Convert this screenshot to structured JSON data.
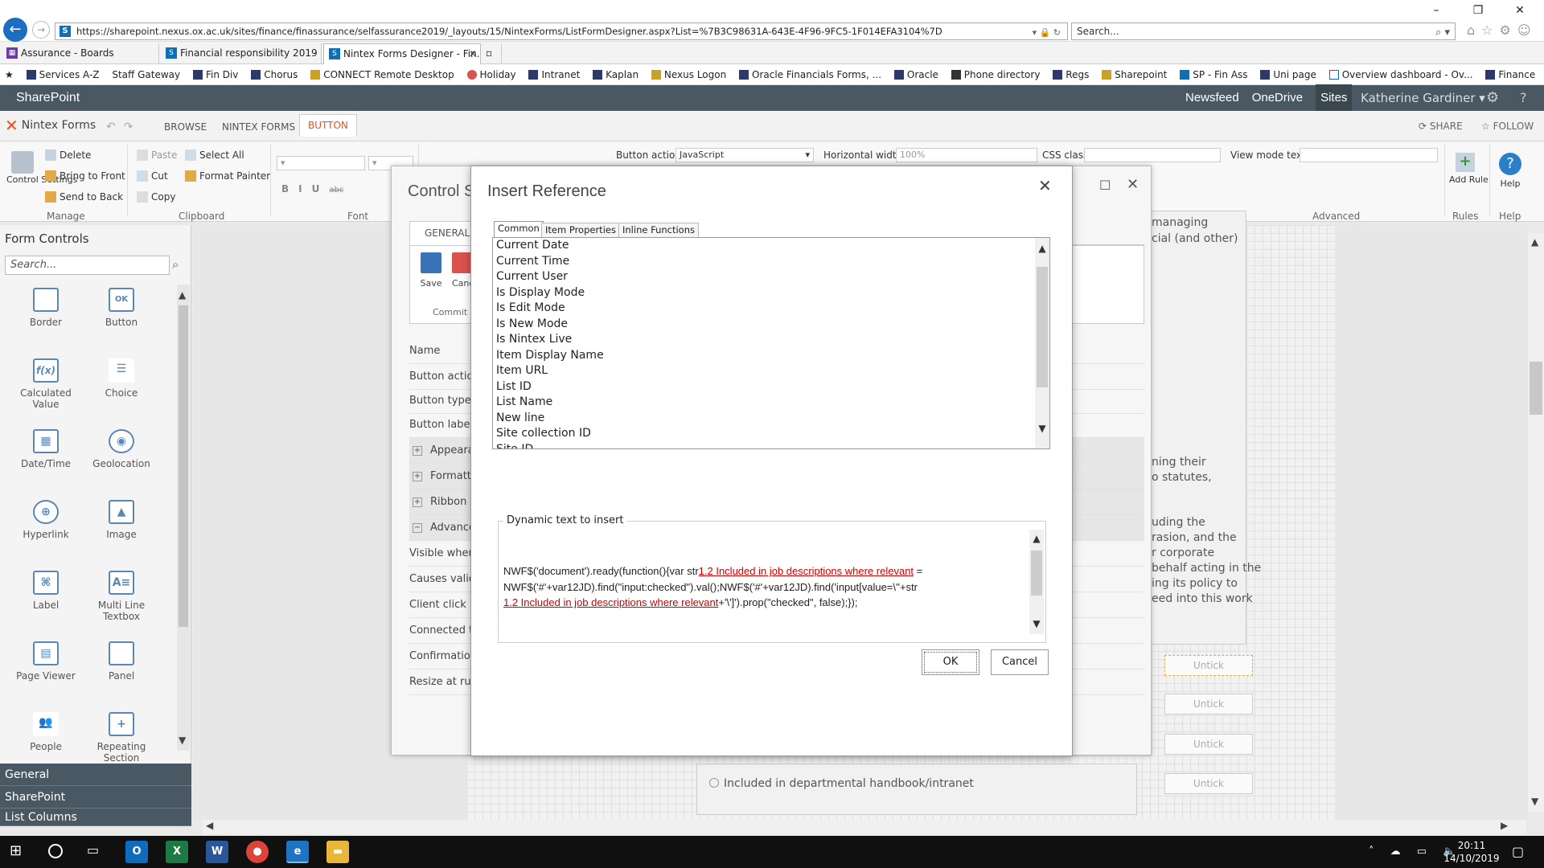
{
  "browser": {
    "url": "https://sharepoint.nexus.ox.ac.uk/sites/finance/finassurance/selfassurance2019/_layouts/15/NintexForms/ListFormDesigner.aspx?List=%7B3C98631A-643E-4F96-9FC5-1F014EFA3104%7D",
    "search_placeholder": "Search...",
    "tabs": [
      "Assurance - Boards",
      "Financial responsibility 2019 - ...",
      "Nintex Forms Designer - Fin..."
    ],
    "favorites": [
      "Services A-Z",
      "Staff Gateway",
      "Fin Div",
      "Chorus",
      "CONNECT Remote Desktop",
      "Holiday",
      "Intranet",
      "Kaplan",
      "Nexus Logon",
      "Oracle Financials Forms, ...",
      "Oracle",
      "Phone directory",
      "Regs",
      "Sharepoint",
      "SP - Fin Ass",
      "Uni page",
      "Overview dashboard - Ov...",
      "Finance"
    ]
  },
  "sharepoint": {
    "brand": "SharePoint",
    "links": [
      "Newsfeed",
      "OneDrive",
      "Sites"
    ],
    "user": "Katherine Gardiner",
    "share": "SHARE",
    "follow": "FOLLOW"
  },
  "ribbon": {
    "app_name": "Nintex Forms",
    "tabs": [
      "BROWSE",
      "NINTEX FORMS",
      "BUTTON"
    ],
    "control_settings": "Control Settings",
    "delete": "Delete",
    "bring_to_front": "Bring to Front",
    "send_to_back": "Send to Back",
    "paste": "Paste",
    "cut": "Cut",
    "copy": "Copy",
    "select_all": "Select All",
    "format_painter": "Format Painter",
    "button_action_label": "Button action",
    "button_action_value": "JavaScript",
    "horizontal_width_label": "Horizontal width",
    "horizontal_width_value": "100%",
    "css_class_label": "CSS class",
    "view_mode_text_label": "View mode text",
    "add_rule": "Add Rule",
    "help": "Help",
    "groups": [
      "Manage",
      "Clipboard",
      "Font",
      "Advanced",
      "Rules",
      "Help"
    ]
  },
  "left_panel": {
    "title": "Form Controls",
    "search_placeholder": "Search...",
    "controls": [
      "Border",
      "Button",
      "Calculated Value",
      "Choice",
      "Date/Time",
      "Geolocation",
      "Hyperlink",
      "Image",
      "Label",
      "Multi Line Textbox",
      "Page Viewer",
      "Panel",
      "People",
      "Repeating Section"
    ],
    "sections": [
      "General",
      "SharePoint",
      "List Columns"
    ]
  },
  "control_settings": {
    "title": "Control Settings",
    "tab": "GENERAL",
    "save": "Save",
    "cancel": "Cancel",
    "commit": "Commit",
    "rows": [
      "Name",
      "Button action",
      "Button type",
      "Button label",
      "Appearance",
      "Formatting",
      "Ribbon",
      "Advanced",
      "Visible when",
      "Causes validation",
      "Client click",
      "Connected to",
      "Confirmation",
      "Resize at runtime"
    ]
  },
  "background_form": {
    "text_1": "managing",
    "text_2": "cial (and other)",
    "text_3": "ning their",
    "text_4": "o statutes,",
    "text_5": "uding the",
    "text_6": "rasion, and the",
    "text_7": "r corporate",
    "text_8": "behalf acting in the",
    "text_9": "ing its policy to",
    "text_10": "eed into this work",
    "untick": "Untick",
    "option": "Included in departmental handbook/intranet"
  },
  "modal": {
    "title": "Insert Reference",
    "tabs": [
      "Common",
      "Item Properties",
      "Inline Functions"
    ],
    "items": [
      "Current Date",
      "Current Time",
      "Current User",
      "Is Display Mode",
      "Is Edit Mode",
      "Is New Mode",
      "Is Nintex Live",
      "Item Display Name",
      "Item URL",
      "List ID",
      "List Name",
      "New line",
      "Site collection ID",
      "Site ID"
    ],
    "dynamic_label": "Dynamic text to insert",
    "code_part1": "NWF$('document').ready(function(){var str",
    "code_ref1": "1.2 Included in job descriptions where relevant",
    "code_part2": " = NWF$('#'+var12JD).find(\"input:checked\").val();NWF$('#'+var12JD).find('input[value=\\''+str",
    "code_ref2": "1.2 Included in job descriptions where relevant",
    "code_part3": "+'\\']').prop(\"checked\", false);});",
    "ok": "OK",
    "cancel": "Cancel"
  },
  "taskbar": {
    "time": "20:11",
    "date": "14/10/2019"
  }
}
